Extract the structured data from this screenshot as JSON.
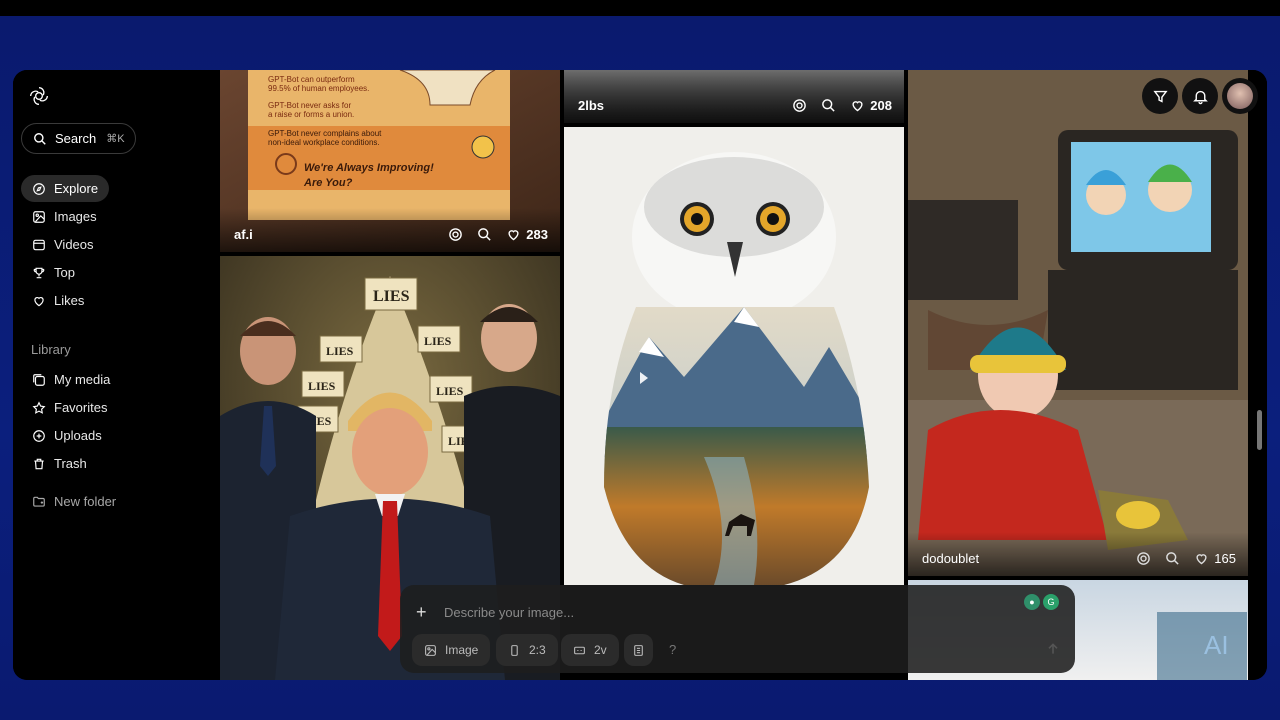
{
  "sidebar": {
    "search_label": "Search",
    "search_shortcut": "⌘K",
    "nav": [
      {
        "label": "Explore",
        "icon": "compass-icon"
      },
      {
        "label": "Images",
        "icon": "image-icon"
      },
      {
        "label": "Videos",
        "icon": "video-icon"
      },
      {
        "label": "Top",
        "icon": "trophy-icon"
      },
      {
        "label": "Likes",
        "icon": "heart-icon"
      }
    ],
    "library_label": "Library",
    "library": [
      {
        "label": "My media",
        "icon": "media-icon"
      },
      {
        "label": "Favorites",
        "icon": "star-icon"
      },
      {
        "label": "Uploads",
        "icon": "upload-icon"
      },
      {
        "label": "Trash",
        "icon": "trash-icon"
      }
    ],
    "new_folder_label": "New folder"
  },
  "tiles": [
    {
      "user": "af.i",
      "likes": "283"
    },
    {
      "user": "2lbs",
      "likes": "208"
    },
    {
      "user": "dodoublet",
      "likes": "165"
    }
  ],
  "poster_text": {
    "line1": "GPT-Bot can outperform",
    "line2": "99.5% of human employees.",
    "line3": "GPT-Bot never asks for",
    "line4": "a raise or forms a union.",
    "line5": "GPT-Bot never complains about",
    "line6": "non-ideal workplace conditions.",
    "slogan1": "We're Always Improving!",
    "slogan2": "Are You?"
  },
  "lies_label": "LIES",
  "composer": {
    "placeholder": "Describe your image...",
    "type_label": "Image",
    "ratio_label": "2:3",
    "variations_label": "2v",
    "help_label": "?"
  },
  "watermark": "AI",
  "colors": {
    "accent_bg": "#0b1f7d",
    "active_nav": "#2a2a2a"
  }
}
